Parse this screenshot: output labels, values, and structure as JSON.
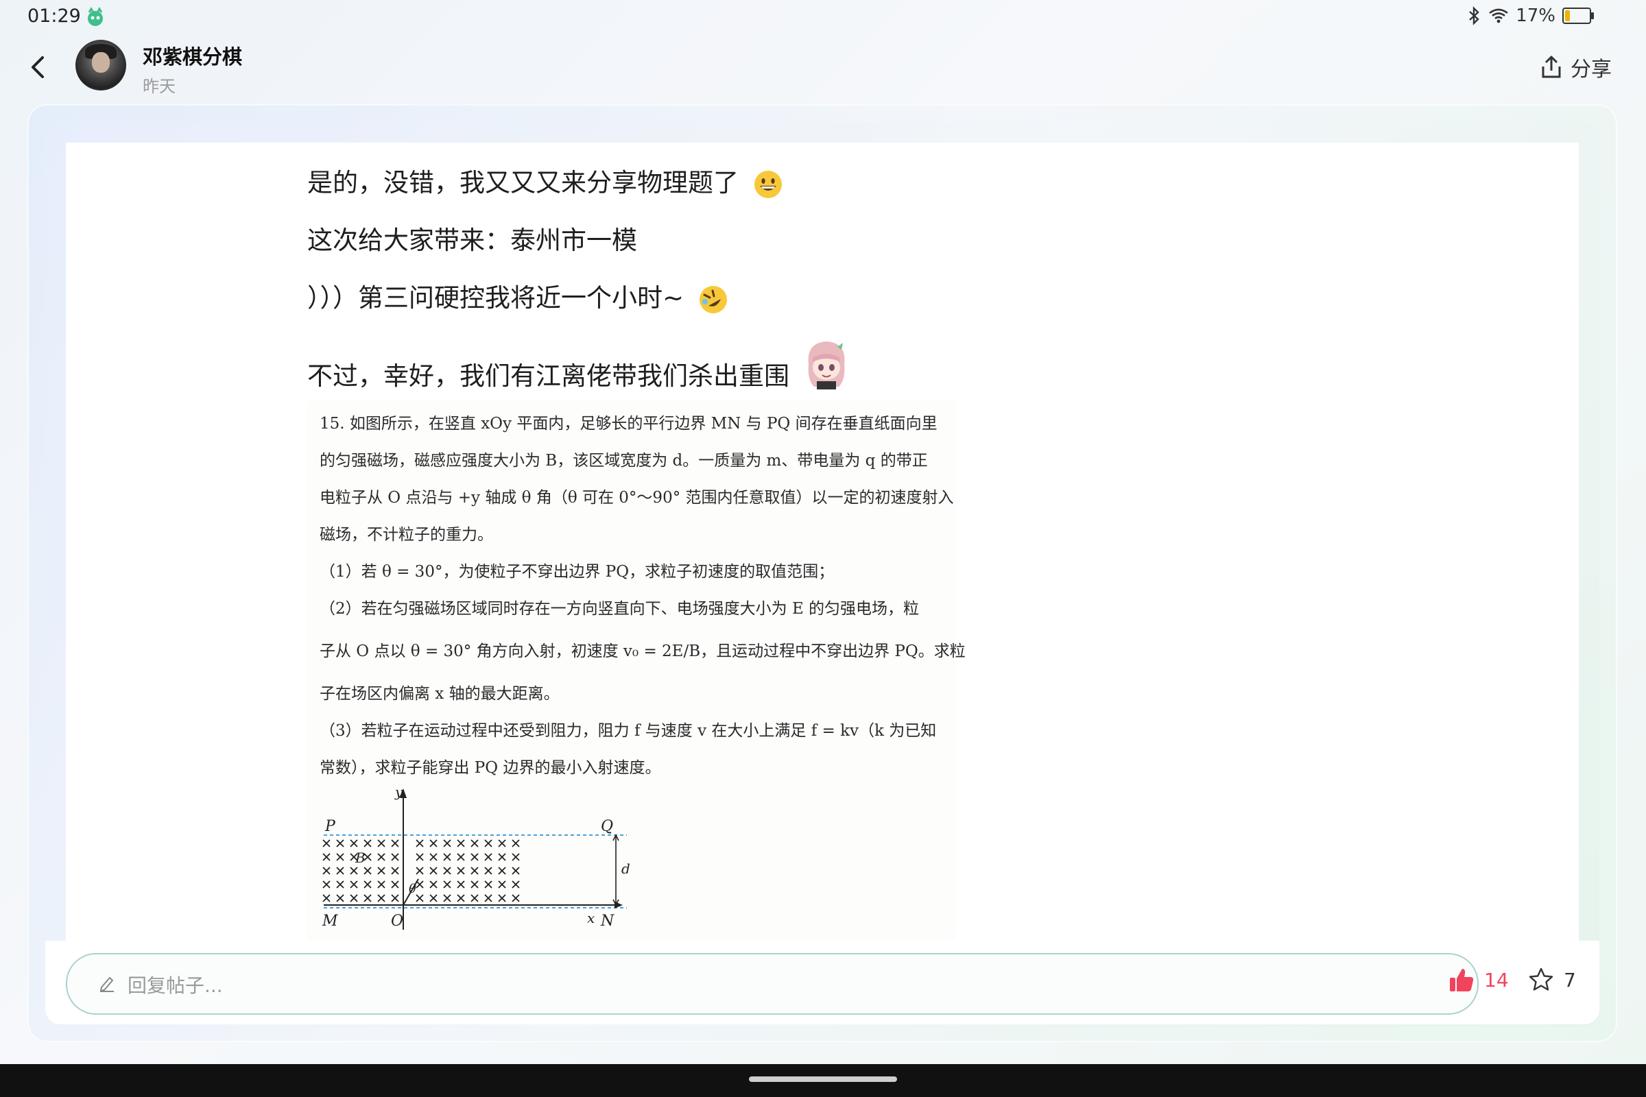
{
  "status_bar": {
    "time": "01:29",
    "battery": "17%",
    "battery_level": 0.17
  },
  "header": {
    "username": "邓紫棋分棋",
    "date": "昨天",
    "share_label": "分享"
  },
  "post": {
    "lines": [
      "是的，没错，我又又又来分享物理题了",
      "这次给大家带来：泰州市一模",
      "）））第三问硬控我将近一个小时~",
      "不过，幸好，我们有江离佬带我们杀出重围"
    ],
    "problem": {
      "lines": [
        "15. 如图所示，在竖直 xOy 平面内，足够长的平行边界 MN 与 PQ 间存在垂直纸面向里",
        "的匀强磁场，磁感应强度大小为 B，该区域宽度为 d。一质量为 m、带电量为 q 的带正",
        "电粒子从 O 点沿与 +y 轴成 θ 角（θ 可在 0°～90° 范围内任意取值）以一定的初速度射入",
        "磁场，不计粒子的重力。",
        "（1）若 θ = 30°，为使粒子不穿出边界 PQ，求粒子初速度的取值范围；",
        "（2）若在匀强磁场区域同时存在一方向竖直向下、电场强度大小为 E 的匀强电场，粒",
        "子从 O 点以 θ = 30° 角方向入射，初速度 v₀ = 2E/B，且运动过程中不穿出边界 PQ。求粒",
        "子在场区内偏离 x 轴的最大距离。",
        "（3）若粒子在运动过程中还受到阻力，阻力 f 与速度 v 在大小上满足 f = kv（k 为已知",
        "常数），求粒子能穿出 PQ 边界的最小入射速度。"
      ],
      "figure_labels": {
        "y": "y",
        "x": "x",
        "P": "P",
        "Q": "Q",
        "M": "M",
        "N": "N",
        "O": "O",
        "B": "B",
        "d": "d",
        "theta": "θ"
      }
    }
  },
  "bottom": {
    "reply_placeholder": "回复帖子...",
    "like_count": "14",
    "fav_count": "7"
  },
  "icons": {
    "back": "back-arrow-icon",
    "share": "share-icon",
    "pencil": "pencil-icon",
    "like": "thumbs-up-icon",
    "fav": "star-icon",
    "bluetooth": "bluetooth-icon",
    "wifi": "wifi-icon"
  },
  "colors": {
    "like": "#f0445d",
    "reply_border": "#a9d2cf"
  }
}
